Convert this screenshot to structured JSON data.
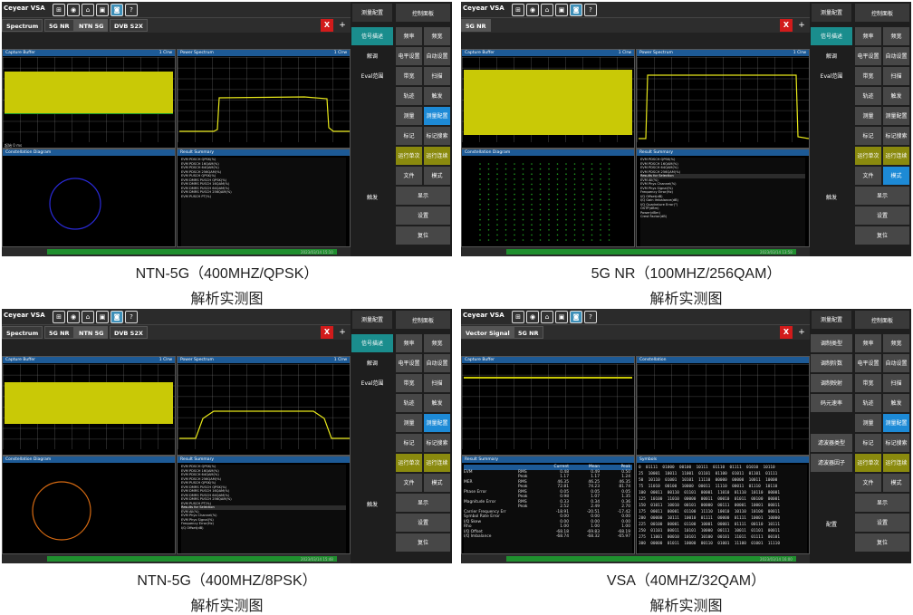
{
  "panels": [
    {
      "brand": "Ceyear VSA",
      "tabs": [
        "Spectrum",
        "5G NR",
        "NTN 5G",
        "DVB S2X"
      ],
      "caption": "NTN-5G（400MHZ/QPSK）",
      "subcaption": "解析实测图",
      "w1": "Capture Buffer",
      "w2": "Power Spectrum",
      "w3": "Constellation Diagram",
      "w4": "Result Summary",
      "clrw": "1 Clrw",
      "start1": "起始 0 ms",
      "start2": "中心 ...",
      "stop2": "终止 ... MHz",
      "timestamp": "2023/03/14 15:10",
      "rows": [
        "EVM PDSCH QPSK(%)",
        "EVM PDSCH 16QAM(%)",
        "EVM PDSCH 64QAM(%)",
        "EVM PDSCH 256QAM(%)",
        "EVM PUSCH QPSK(%)",
        "EVM DMRS PUSCH QPSK(%)",
        "EVM DMRS PUSCH 16QAM(%)",
        "EVM DMRS PUSCH 64QAM(%)",
        "EVM DMRS PUSCH 256QAM(%)",
        "EVM PUSCH PT(%)"
      ]
    },
    {
      "brand": "Ceyear VSA",
      "tabs": [
        "5G NR"
      ],
      "caption": "5G NR（100MHZ/256QAM）",
      "subcaption": "解析实测图",
      "w1": "Capture Buffer",
      "w2": "Power Spectrum",
      "w3": "Constellation Diagram",
      "w4": "Result Summary",
      "clrw": "1 Clrw",
      "timestamp": "2023/03/14 13:58",
      "rows": [
        "EVM PDSCH QPSK(%)",
        "EVM PDSCH 16QAM(%)",
        "EVM PDSCH 64QAM(%)",
        "EVM PDSCH 256QAM(%)",
        "Results for Selection",
        "EVM All(%)",
        "EVM Phys Channel(%)",
        "EVM Phys Signal(%)",
        "Frequency Error(Hz)",
        "I/Q Offset(dB)",
        "I/Q Gain Imbalance(dB)",
        "I/Q Quadrature Error(°)",
        "OSTP(dBm)",
        "Power(dBm)",
        "Crest Factor(dB)"
      ]
    },
    {
      "brand": "Ceyear VSA",
      "tabs": [
        "Spectrum",
        "5G NR",
        "NTN 5G",
        "DVB S2X"
      ],
      "caption": "NTN-5G（400MHZ/8PSK）",
      "subcaption": "解析实测图",
      "w1": "Capture Buffer",
      "w2": "Power Spectrum",
      "w3": "Constellation Diagram",
      "w4": "Result Summary",
      "clrw": "1 Clrw",
      "timestamp": "2023/03/14 15:48",
      "rows": [
        "EVM PDSCH QPSK(%)",
        "EVM PDSCH 16QAM(%)",
        "EVM PDSCH 64QAM(%)",
        "EVM PDSCH 256QAM(%)",
        "EVM PUSCH QPSK(%)",
        "EVM DMRS PUSCH QPSK(%)",
        "EVM DMRS PUSCH 16QAM(%)",
        "EVM DMRS PUSCH 64QAM(%)",
        "EVM DMRS PUSCH 256QAM(%)",
        "EVM PUSCH PT(%)",
        "Results for Selection",
        "EVM All(%)",
        "EVM Phys Channel(%)",
        "EVM Phys Signal(%)",
        "Frequency Error(Hz)",
        "I/Q Offset(dB)"
      ]
    },
    {
      "brand": "Ceyear VSA",
      "tabs": [
        "Vector Signal",
        "5G NR"
      ],
      "caption": "VSA（40MHZ/32QAM）",
      "subcaption": "解析实测图",
      "w1": "Capture Buffer",
      "w2": "Constellation",
      "w3": "Result Summary",
      "w4": "Symbols",
      "timestamp": "2023/03/14 16:00",
      "summary_header": [
        "",
        "",
        "Current",
        "Mean",
        "Peak"
      ],
      "summary": [
        [
          "EVM",
          "RMS",
          "0.48",
          "0.49",
          "0.50"
        ],
        [
          "",
          "Peak",
          "1.17",
          "1.17",
          "1.24"
        ],
        [
          "MER",
          "RMS",
          "46.35",
          "46.25",
          "46.35"
        ],
        [
          "",
          "Peak",
          "72.81",
          "74.23",
          "81.74"
        ],
        [
          "Phase Error",
          "RMS",
          "0.05",
          "0.05",
          "0.05"
        ],
        [
          "",
          "Peak",
          "0.98",
          "1.07",
          "1.35"
        ],
        [
          "Magnitude Error",
          "RMS",
          "0.33",
          "0.34",
          "0.36"
        ],
        [
          "",
          "Peak",
          "2.52",
          "2.49",
          "2.70"
        ],
        [
          "Carrier Frequency Err",
          "",
          "-18.91",
          "-20.51",
          "-17.42"
        ],
        [
          "Symbol Rate Error",
          "",
          "0.00",
          "0.00",
          "0.00"
        ],
        [
          "I/Q Skew",
          "",
          "0.00",
          "0.00",
          "0.00"
        ],
        [
          "Rho",
          "",
          "1.00",
          "1.00",
          "1.00"
        ],
        [
          "I/Q Offset",
          "",
          "-68.18",
          "-69.83",
          "-68.19"
        ],
        [
          "I/Q Imbalance",
          "",
          "-68.74",
          "-68.32",
          "-65.97"
        ]
      ],
      "symbols": [
        [
          "0",
          "01111",
          "01000",
          "00100",
          "10111",
          "01110",
          "01111",
          "01010",
          "10110"
        ],
        [
          "25",
          "10001",
          "10011",
          "11001",
          "01101",
          "01100",
          "01011",
          "01101",
          "01111"
        ],
        [
          "50",
          "10110",
          "01001",
          "10101",
          "11110",
          "00000",
          "00000",
          "10011",
          "10000"
        ],
        [
          "75",
          "11010",
          "00100",
          "10000",
          "00011",
          "11110",
          "00011",
          "01110",
          "10110"
        ],
        [
          "100",
          "00011",
          "00110",
          "01101",
          "00001",
          "11010",
          "01110",
          "10110",
          "00001"
        ],
        [
          "125",
          "10100",
          "11010",
          "00000",
          "00011",
          "00010",
          "01011",
          "00100",
          "00001"
        ],
        [
          "150",
          "01011",
          "10010",
          "00101",
          "00000",
          "00111",
          "00001",
          "10001",
          "00011"
        ],
        [
          "175",
          "00011",
          "00001",
          "01100",
          "11110",
          "10010",
          "10110",
          "10100",
          "00011"
        ],
        [
          "200",
          "00000",
          "10111",
          "10010",
          "01111",
          "00000",
          "01111",
          "10001",
          "10000"
        ],
        [
          "225",
          "00100",
          "00001",
          "01100",
          "10001",
          "00001",
          "01111",
          "00110",
          "10111"
        ],
        [
          "250",
          "01101",
          "00011",
          "10101",
          "10000",
          "00111",
          "10011",
          "01101",
          "00011"
        ],
        [
          "275",
          "11001",
          "00010",
          "10101",
          "10100",
          "00101",
          "11011",
          "01111",
          "00101"
        ],
        [
          "300",
          "00000",
          "01011",
          "10000",
          "00110",
          "01001",
          "11100",
          "01001",
          "11110"
        ]
      ]
    }
  ],
  "menus": {
    "ntn": {
      "mid": [
        "信号描述",
        "解调",
        "Eval范围",
        "触发"
      ],
      "right": [
        "频率",
        "频宽",
        "电平设置",
        "自动设置",
        "带宽",
        "扫描",
        "轨迹",
        "触发",
        "测量",
        "测量配置",
        "标记",
        "标记搜索",
        "运行单次",
        "运行连续",
        "文件",
        "模式",
        "显示",
        "设置",
        "复位"
      ]
    },
    "vsa": {
      "mid": [
        "测量配置",
        "调制类型",
        "调制阶数",
        "调制映射",
        "码元速率",
        "滤波器类型",
        "滤波器因子",
        "配置"
      ],
      "right": [
        "频率",
        "频宽",
        "电平设置",
        "自动设置",
        "带宽",
        "扫描",
        "轨迹",
        "触发",
        "测量",
        "测量配置",
        "标记",
        "标记搜索",
        "运行单次",
        "运行连续",
        "文件",
        "模式",
        "显示",
        "设置",
        "复位"
      ]
    },
    "top_mid": "测量配置",
    "top_right": "控制面板"
  }
}
